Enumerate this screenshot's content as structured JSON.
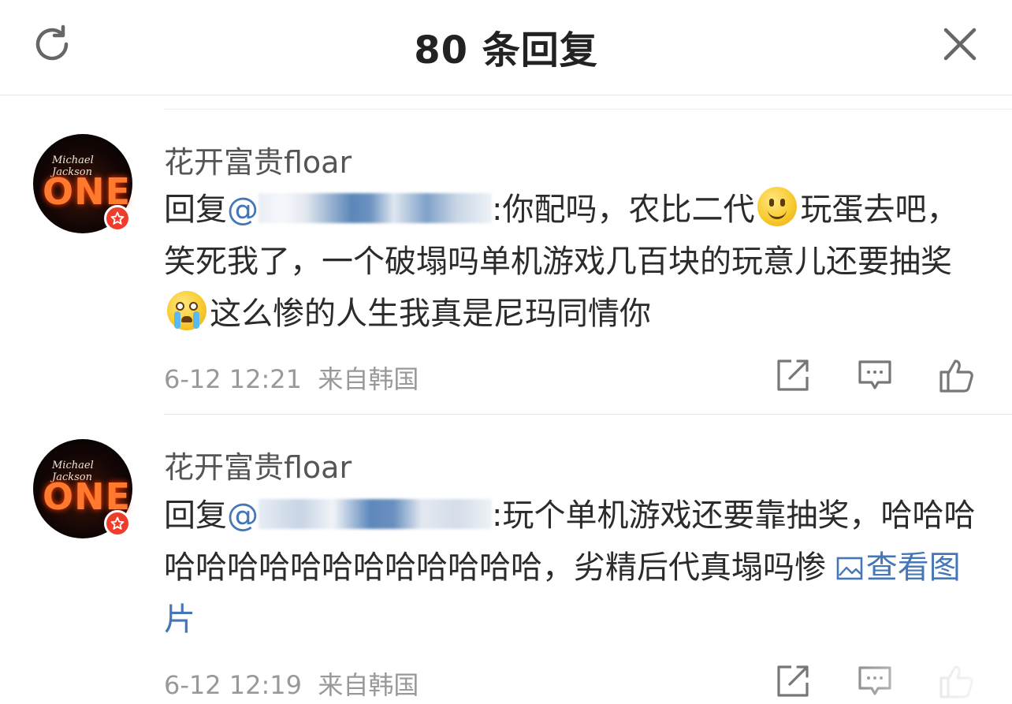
{
  "header": {
    "title": "80 条回复"
  },
  "comments": [
    {
      "author": "花开富贵floar",
      "reply_prefix": "回复",
      "mention": "@",
      "text_part1": ":你配吗，农比二代",
      "emoji1": "smile",
      "text_part2": "玩蛋去吧，笑死我了，一个破塌吗单机游戏几百块的玩意儿还要抽奖",
      "emoji2": "cry",
      "text_part3": "这么惨的人生我真是尼玛同情你",
      "time": "6-12 12:21",
      "source": "来自韩国"
    },
    {
      "author": "花开富贵floar",
      "reply_prefix": "回复",
      "mention": "@",
      "text_part1": ":玩个单机游戏还要靠抽奖，哈哈哈哈哈哈哈哈哈哈哈哈哈哈哈，劣精后代真塌吗惨 ",
      "view_image": "查看图片",
      "time": "6-12 12:19",
      "source": "来自韩国"
    }
  ],
  "icons": {
    "refresh": "refresh-icon",
    "close": "close-icon",
    "repost": "repost-icon",
    "comment": "comment-icon",
    "like": "like-icon",
    "verified_badge": "star-badge-icon",
    "picture": "picture-icon"
  },
  "colors": {
    "link": "#4577b8",
    "meta": "#999999",
    "badge": "#ef3d2c"
  }
}
